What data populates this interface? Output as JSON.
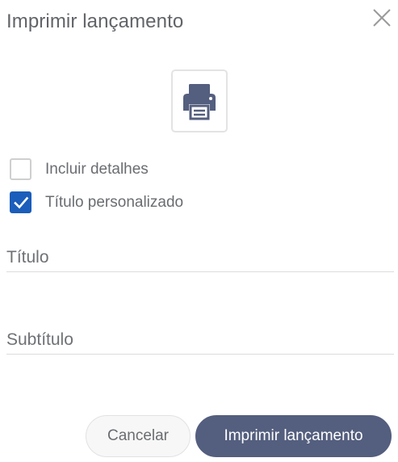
{
  "dialog": {
    "title": "Imprimir lançamento",
    "close_icon": "close-icon",
    "print_icon": "printer-icon"
  },
  "options": [
    {
      "label": "Incluir detalhes",
      "checked": false
    },
    {
      "label": "Título personalizado",
      "checked": true
    }
  ],
  "fields": {
    "title_placeholder": "Título",
    "subtitle_placeholder": "Subtítulo"
  },
  "actions": {
    "cancel_label": "Cancelar",
    "print_label": "Imprimir lançamento"
  },
  "colors": {
    "accent": "#1a5dba",
    "primary_button": "#545e7e",
    "printer_icon": "#545e7e"
  }
}
